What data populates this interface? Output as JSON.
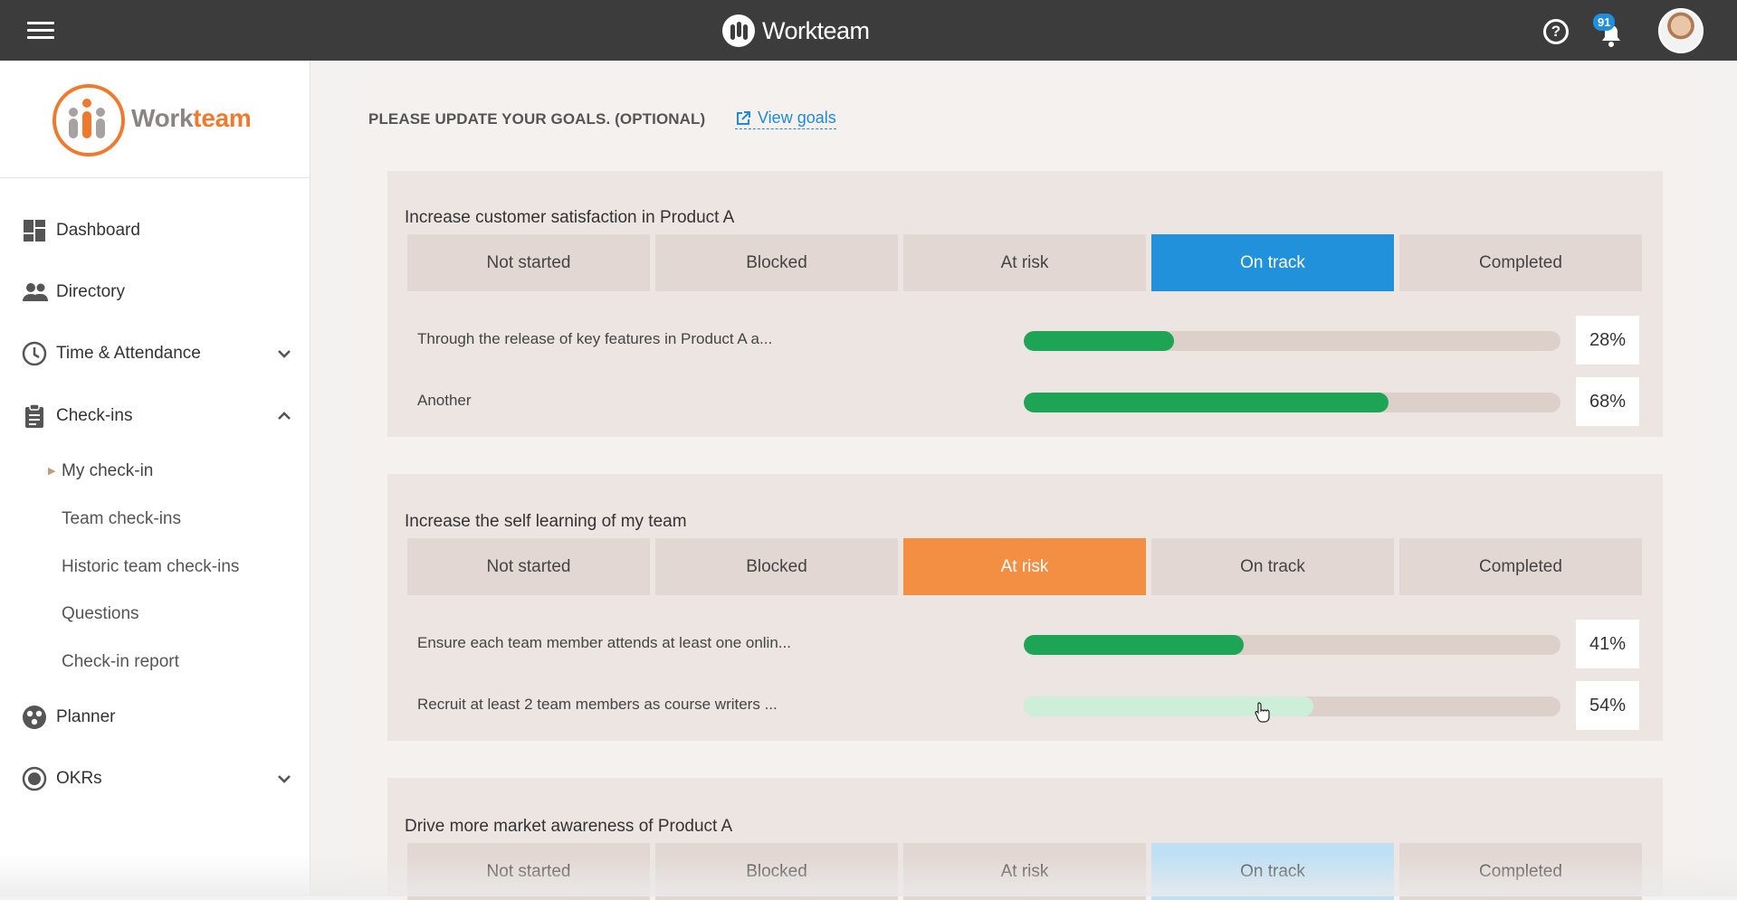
{
  "topbar": {
    "brand": "Workteam",
    "notification_count": "91"
  },
  "sidebar": {
    "brand_prefix": "Work",
    "brand_suffix": "team",
    "items": [
      {
        "label": "Dashboard",
        "icon": "dashboard-icon"
      },
      {
        "label": "Directory",
        "icon": "people-icon"
      },
      {
        "label": "Time & Attendance",
        "icon": "clock-icon",
        "expanded": false
      },
      {
        "label": "Check-ins",
        "icon": "clipboard-icon",
        "expanded": true
      },
      {
        "label": "Planner",
        "icon": "planner-icon"
      },
      {
        "label": "OKRs",
        "icon": "target-icon",
        "expanded": false
      }
    ],
    "checkins_sub": [
      {
        "label": "My check-in",
        "active": true
      },
      {
        "label": "Team check-ins"
      },
      {
        "label": "Historic team check-ins"
      },
      {
        "label": "Questions"
      },
      {
        "label": "Check-in report"
      }
    ]
  },
  "main": {
    "heading": "PLEASE UPDATE YOUR GOALS. (OPTIONAL)",
    "view_goals_label": "View goals",
    "status_options": [
      "Not started",
      "Blocked",
      "At risk",
      "On track",
      "Completed"
    ],
    "goals": [
      {
        "title": "Increase customer satisfaction in Product A",
        "selected_status": "On track",
        "key_results": [
          {
            "text": "Through the release of key features in Product A a...",
            "progress": 28,
            "label": "28%"
          },
          {
            "text": "Another",
            "progress": 68,
            "label": "68%"
          }
        ]
      },
      {
        "title": "Increase the self learning of my team",
        "selected_status": "At risk",
        "key_results": [
          {
            "text": "Ensure each team member attends at least one onlin...",
            "progress": 41,
            "label": "41%"
          },
          {
            "text": "Recruit at least 2 team members as course writers ...",
            "progress": 54,
            "label": "54%"
          }
        ]
      },
      {
        "title": "Drive more market awareness of Product A",
        "selected_status": "On track",
        "key_results": []
      }
    ]
  },
  "colors": {
    "topbar": "#3c3c3c",
    "brand_orange": "#ef7a2e",
    "on_track_blue": "#2191dc",
    "at_risk_orange": "#f28f43",
    "progress_green": "#1ea455",
    "link_blue": "#1f8ad8"
  }
}
